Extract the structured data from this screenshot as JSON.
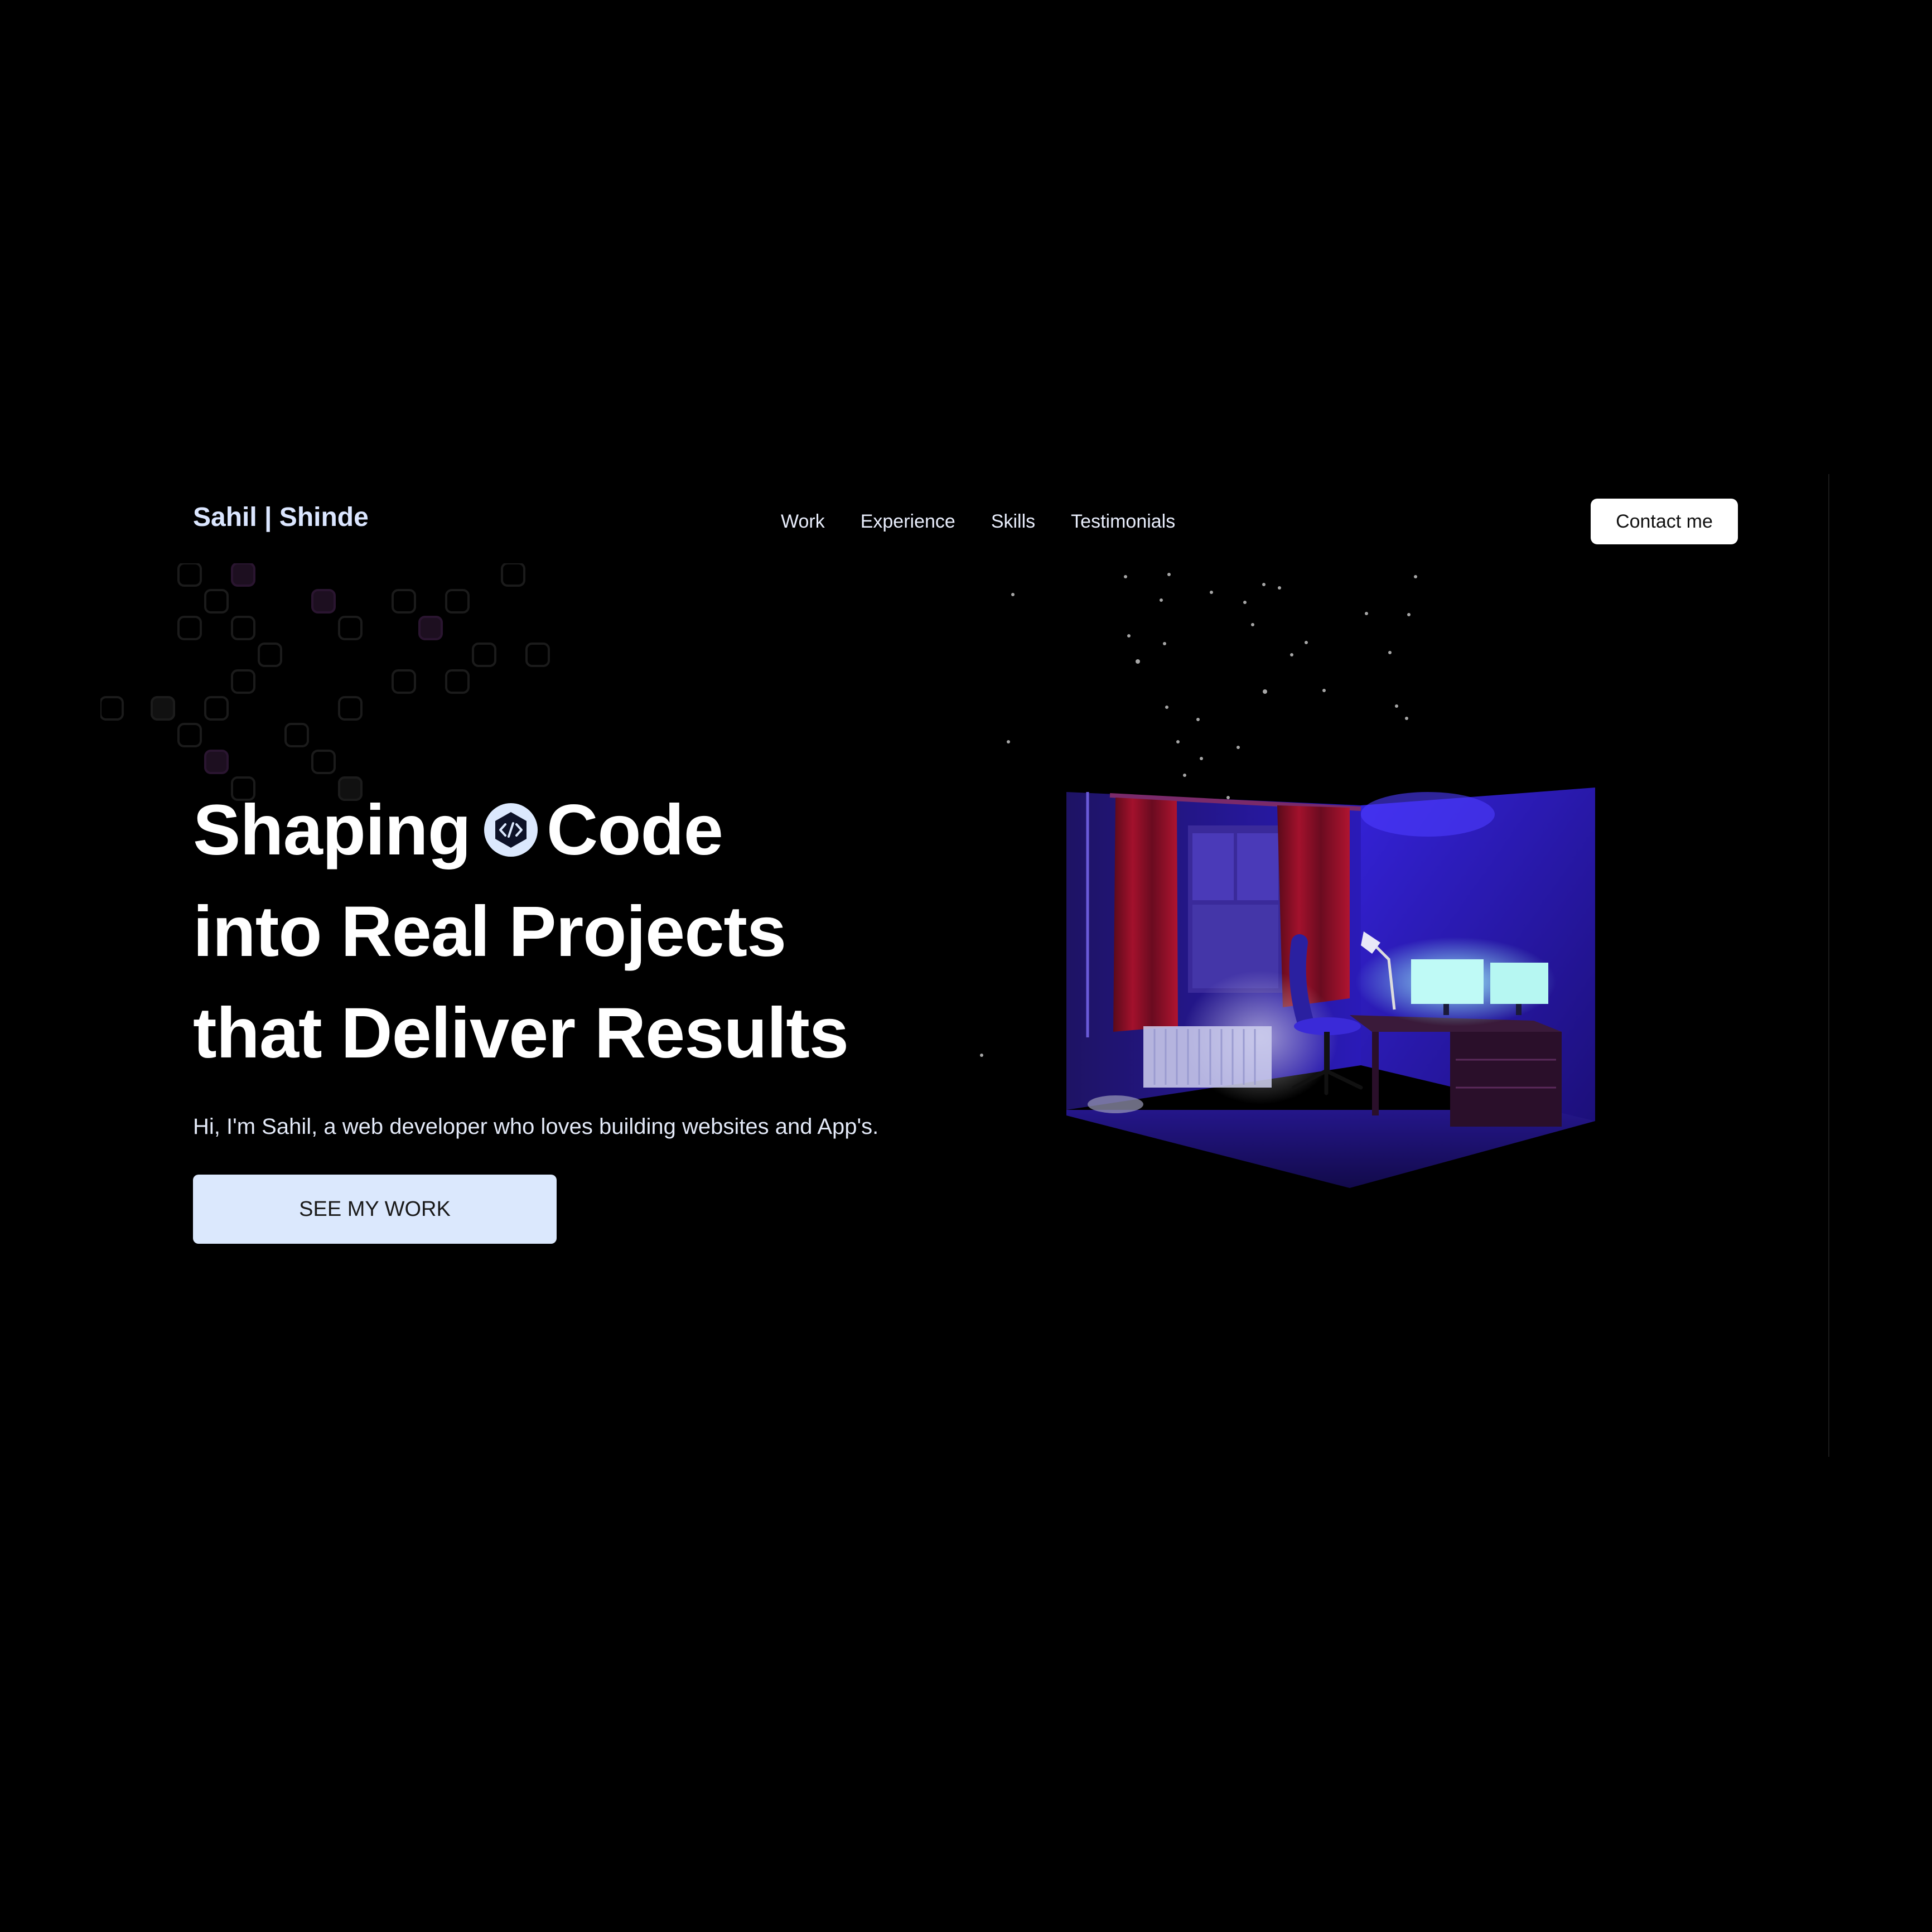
{
  "header": {
    "logo": "Sahil | Shinde",
    "nav": [
      {
        "label": "Work"
      },
      {
        "label": "Experience"
      },
      {
        "label": "Skills"
      },
      {
        "label": "Testimonials"
      }
    ],
    "contact_label": "Contact me"
  },
  "hero": {
    "line1_word1": "Shaping",
    "line1_word2": "Code",
    "line2": "into Real Projects",
    "line3": "that Deliver Results",
    "subtitle": "Hi, I'm Sahil, a web developer who loves building websites and App's.",
    "cta_label": "SEE MY WORK"
  },
  "icons": {
    "code_badge": "code-icon",
    "room": "room-illustration"
  },
  "colors": {
    "background": "#000000",
    "logo": "#dbe6ff",
    "cta_bg": "#dbe8fd",
    "contact_bg": "#ffffff",
    "room_accent": "#2a18b8"
  }
}
